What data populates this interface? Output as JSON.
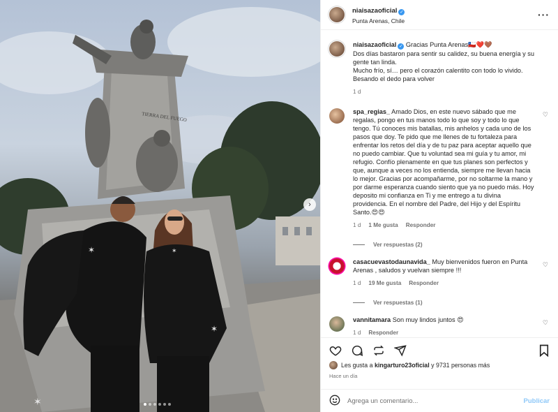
{
  "header": {
    "username": "niaisazaoficial",
    "location": "Punta Arenas, Chile",
    "more_icon": "more-horizontal-icon"
  },
  "caption": {
    "username": "niaisazaoficial",
    "text_line1": "Gracias Punta Arenas🇨🇱❤️🤎",
    "text_line2": "Dos días bastaron para sentir su calidez, su buena energía y su gente tan linda.",
    "text_line3": "Mucho frío, sí… pero el corazón calentito con todo lo vivido.",
    "text_line4": "Besando el dedo para volver",
    "time": "1 d"
  },
  "comments": [
    {
      "username": "spa_regias_",
      "text": "Amado Dios, en este nuevo sábado que me regalas, pongo en tus manos todo lo que soy y todo lo que tengo. Tú conoces mis batallas, mis anhelos y cada uno de los pasos que doy. Te pido que me llenes de tu fortaleza para enfrentar los retos del día y de tu paz para aceptar aquello que no puedo cambiar. Que tu voluntad sea mi guía y tu amor, mi refugio. Confío plenamente en que tus planes son perfectos y que, aunque a veces no los entienda, siempre me llevan hacia lo mejor. Gracias por acompañarme, por no soltarme la mano y por darme esperanza cuando siento que ya no puedo más. Hoy deposito mi confianza en Ti y me entrego a tu divina providencia. En el nombre del Padre, del Hijo y del Espíritu Santo.😍😍",
      "time": "1 d",
      "likes": "1 Me gusta",
      "reply": "Responder",
      "view_replies": "Ver respuestas (2)"
    },
    {
      "username": "casacuevastodaunavida_",
      "text": "Muy bienvenidos fueron en Punta Arenas , saludos y vuelvan siempre !!!",
      "time": "1 d",
      "likes": "19 Me gusta",
      "reply": "Responder",
      "view_replies": "Ver respuestas (1)"
    },
    {
      "username": "vannitamara",
      "text": "Son muy lindos juntos 😍",
      "time": "1 d",
      "reply": "Responder"
    }
  ],
  "actions": {
    "liked_by_prefix": "Les gusta a",
    "liked_by_user": "kingarturo23oficial",
    "liked_by_suffix": "y 9731 personas más",
    "posted_ago": "Hace un día",
    "comment_placeholder": "Agrega un comentario...",
    "post_label": "Publicar"
  },
  "photo": {
    "monument_plaque": "TIERRA DEL FUEGO",
    "carousel_count": 6,
    "carousel_active": 1
  },
  "colors": {
    "link_blue": "#3897f0",
    "publish_disabled": "#8ec8f8",
    "muted_text": "#737373"
  }
}
